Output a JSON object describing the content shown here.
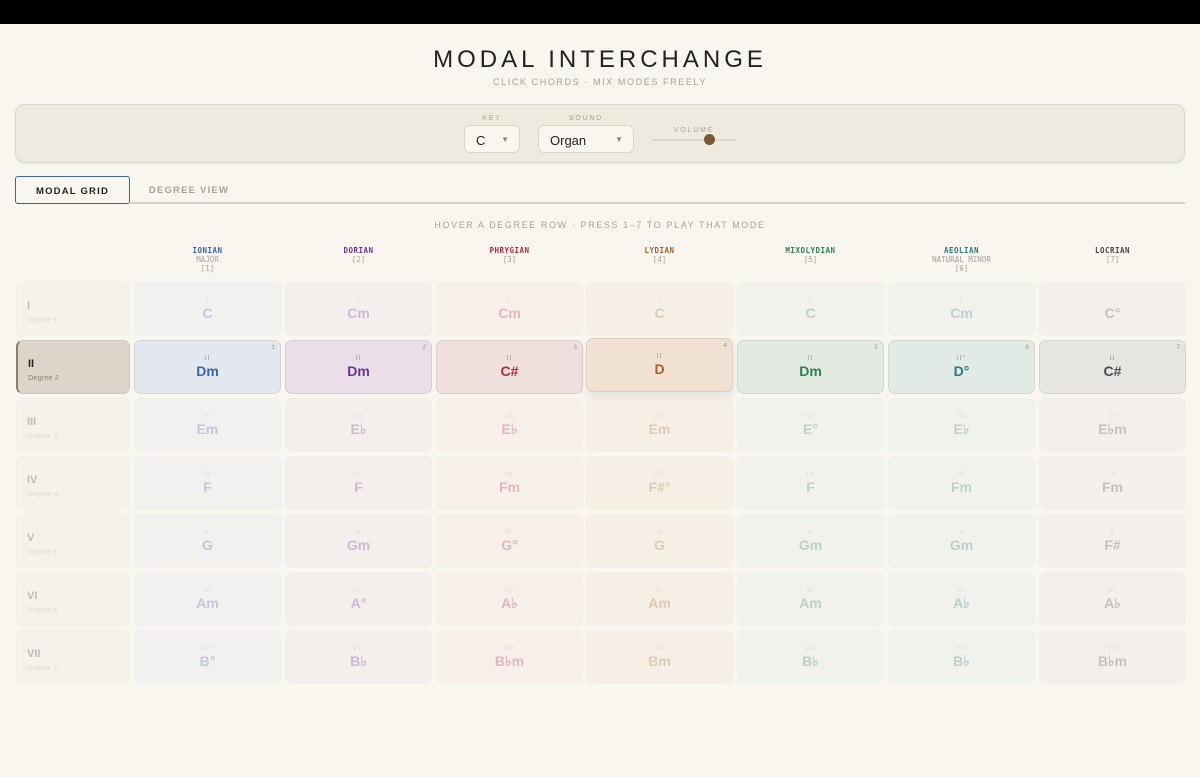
{
  "header": {
    "title": "MODAL INTERCHANGE",
    "subtitle": "CLICK CHORDS · MIX MODES FREELY"
  },
  "controls": {
    "key_label": "KEY",
    "key_value": "C",
    "sound_label": "SOUND",
    "sound_value": "Organ",
    "volume_label": "VOLUME",
    "volume_percent": 68
  },
  "tabs": [
    {
      "label": "MODAL GRID",
      "active": true
    },
    {
      "label": "DEGREE VIEW",
      "active": false
    }
  ],
  "hint": "HOVER A DEGREE ROW · PRESS 1–7 TO PLAY THAT MODE",
  "active_row": 1,
  "hover_mode": 3,
  "modes": [
    {
      "name": "IONIAN",
      "alias": "MAJOR",
      "index": "[1]",
      "key": "1",
      "color": "#3a64b0",
      "bg": "#e3e7ee"
    },
    {
      "name": "DORIAN",
      "alias": "",
      "index": "[2]",
      "key": "2",
      "color": "#6b2fa0",
      "bg": "#eadfe8"
    },
    {
      "name": "PHRYGIAN",
      "alias": "",
      "index": "[3]",
      "key": "3",
      "color": "#b02a3a",
      "bg": "#f0e0dd"
    },
    {
      "name": "LYDIAN",
      "alias": "",
      "index": "[4]",
      "key": "4",
      "color": "#a8602a",
      "bg": "#f0e1d2"
    },
    {
      "name": "MIXOLYDIAN",
      "alias": "",
      "index": "[5]",
      "key": "5",
      "color": "#2e8050",
      "bg": "#e2eae1"
    },
    {
      "name": "AEOLIAN",
      "alias": "NATURAL MINOR",
      "index": "[6]",
      "key": "6",
      "color": "#2e7a80",
      "bg": "#e2eae5"
    },
    {
      "name": "LOCRIAN",
      "alias": "",
      "index": "[7]",
      "key": "7",
      "color": "#4a4a4a",
      "bg": "#e7e5e1"
    }
  ],
  "rows": [
    {
      "numeral": "I",
      "degree": "Degree 1",
      "cells": [
        [
          "I",
          "C"
        ],
        [
          "I",
          "Cm"
        ],
        [
          "I",
          "Cm"
        ],
        [
          "I",
          "C"
        ],
        [
          "I",
          "C"
        ],
        [
          "I",
          "Cm"
        ],
        [
          "I°",
          "C°"
        ]
      ]
    },
    {
      "numeral": "II",
      "degree": "Degree 2",
      "cells": [
        [
          "II",
          "Dm"
        ],
        [
          "II",
          "Dm"
        ],
        [
          "II",
          "C#"
        ],
        [
          "II",
          "D"
        ],
        [
          "II",
          "Dm"
        ],
        [
          "II°",
          "D°"
        ],
        [
          "II",
          "C#"
        ]
      ]
    },
    {
      "numeral": "III",
      "degree": "Degree 3",
      "cells": [
        [
          "III",
          "Em"
        ],
        [
          "III",
          "E♭"
        ],
        [
          "III",
          "E♭"
        ],
        [
          "III",
          "Em"
        ],
        [
          "III°",
          "E°"
        ],
        [
          "III",
          "E♭"
        ],
        [
          "III",
          "E♭m"
        ]
      ]
    },
    {
      "numeral": "IV",
      "degree": "Degree 4",
      "cells": [
        [
          "IV",
          "F"
        ],
        [
          "IV",
          "F"
        ],
        [
          "IV",
          "Fm"
        ],
        [
          "IV°",
          "F#°"
        ],
        [
          "IV",
          "F"
        ],
        [
          "IV",
          "Fm"
        ],
        [
          "IV",
          "Fm"
        ]
      ]
    },
    {
      "numeral": "V",
      "degree": "Degree 5",
      "cells": [
        [
          "V",
          "G"
        ],
        [
          "V",
          "Gm"
        ],
        [
          "V°",
          "G°"
        ],
        [
          "V",
          "G"
        ],
        [
          "V",
          "Gm"
        ],
        [
          "V",
          "Gm"
        ],
        [
          "V",
          "F#"
        ]
      ]
    },
    {
      "numeral": "VI",
      "degree": "Degree 6",
      "cells": [
        [
          "VI",
          "Am"
        ],
        [
          "VI°",
          "A°"
        ],
        [
          "VI",
          "A♭"
        ],
        [
          "VI",
          "Am"
        ],
        [
          "VI",
          "Am"
        ],
        [
          "VI",
          "A♭"
        ],
        [
          "VI",
          "A♭"
        ]
      ]
    },
    {
      "numeral": "VII",
      "degree": "Degree 7",
      "cells": [
        [
          "VII°",
          "B°"
        ],
        [
          "VII",
          "B♭"
        ],
        [
          "VII",
          "B♭m"
        ],
        [
          "VII",
          "Bm"
        ],
        [
          "VII",
          "B♭"
        ],
        [
          "VII",
          "B♭"
        ],
        [
          "VII",
          "B♭m"
        ]
      ]
    }
  ]
}
